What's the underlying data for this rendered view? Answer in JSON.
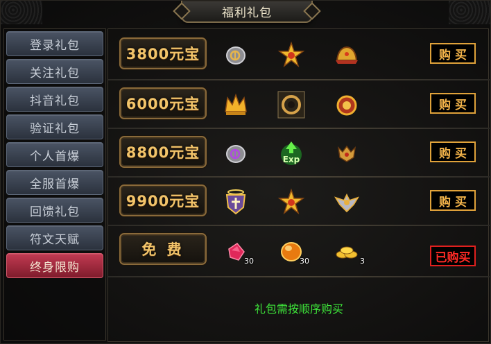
{
  "window": {
    "title": "福利礼包"
  },
  "sidebar": {
    "items": [
      {
        "label": "登录礼包",
        "active": false
      },
      {
        "label": "关注礼包",
        "active": false
      },
      {
        "label": "抖音礼包",
        "active": false
      },
      {
        "label": "验证礼包",
        "active": false
      },
      {
        "label": "个人首爆",
        "active": false
      },
      {
        "label": "全服首爆",
        "active": false
      },
      {
        "label": "回馈礼包",
        "active": false
      },
      {
        "label": "符文天赋",
        "active": false
      },
      {
        "label": "终身限购",
        "active": true
      }
    ]
  },
  "packages": [
    {
      "price": "3800元宝",
      "button": "购买",
      "items": [
        {
          "icon": "rune-stone-icon",
          "count": ""
        },
        {
          "icon": "golden-star-emblem-icon",
          "count": ""
        },
        {
          "icon": "golden-helmet-icon",
          "count": ""
        }
      ]
    },
    {
      "price": "6000元宝",
      "button": "购买",
      "items": [
        {
          "icon": "golden-crown-icon",
          "count": ""
        },
        {
          "icon": "dark-ring-orb-icon",
          "count": ""
        },
        {
          "icon": "flame-medallion-icon",
          "count": ""
        }
      ]
    },
    {
      "price": "8800元宝",
      "button": "购买",
      "items": [
        {
          "icon": "purple-rune-stone-icon",
          "count": ""
        },
        {
          "icon": "exp-scroll-icon",
          "count": ""
        },
        {
          "icon": "small-wing-emblem-icon",
          "count": ""
        }
      ]
    },
    {
      "price": "9900元宝",
      "button": "购买",
      "items": [
        {
          "icon": "holy-shield-icon",
          "count": ""
        },
        {
          "icon": "golden-star-emblem-icon",
          "count": ""
        },
        {
          "icon": "winged-crest-icon",
          "count": ""
        }
      ]
    },
    {
      "price": "免 费",
      "button": "已购买",
      "items": [
        {
          "icon": "red-gem-icon",
          "count": "30"
        },
        {
          "icon": "amber-stone-icon",
          "count": "30"
        },
        {
          "icon": "gold-coins-icon",
          "count": "3"
        }
      ]
    }
  ],
  "notice": "礼包需按顺序购买",
  "colors": {
    "accent": "#f4b44a",
    "active_tab": "#a32a3e",
    "notice": "#3ee63a",
    "bought": "#ff2b26"
  }
}
